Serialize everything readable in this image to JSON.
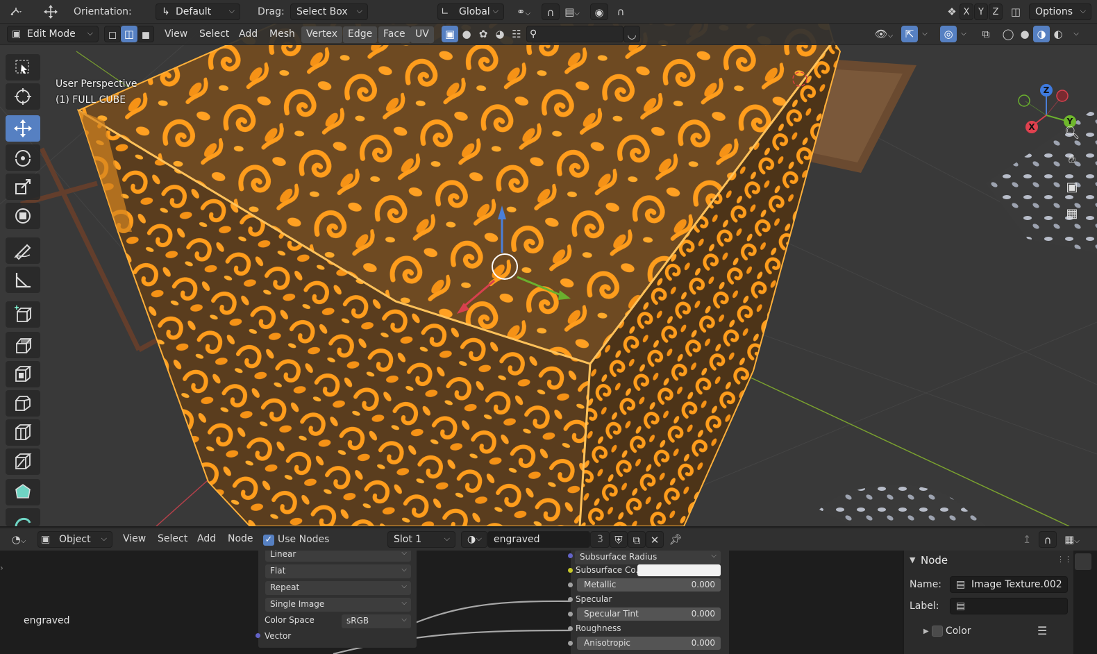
{
  "header": {
    "orientation_label": "Orientation:",
    "orientation_value": "Default",
    "drag_label": "Drag:",
    "drag_value": "Select Box",
    "transform_orientation": "Global",
    "mirror_x": "X",
    "mirror_y": "Y",
    "mirror_z": "Z",
    "options": "Options"
  },
  "header2": {
    "mode": "Edit Mode",
    "menus": [
      "View",
      "Select",
      "Add",
      "Mesh",
      "Vertex",
      "Edge",
      "Face",
      "UV"
    ],
    "highlighted_menus": [
      "Vertex",
      "Edge",
      "Face",
      "UV"
    ]
  },
  "viewport": {
    "perspective": "User Perspective",
    "object": "(1) FULL CUBE",
    "axis_x": "X",
    "axis_y": "Y",
    "axis_z": "Z"
  },
  "node_editor": {
    "header": {
      "editor_type": "Object",
      "menus": [
        "View",
        "Select",
        "Add",
        "Node"
      ],
      "use_nodes_label": "Use Nodes",
      "use_nodes_checked": true,
      "slot": "Slot 1",
      "material": "engraved",
      "user_count": "3"
    },
    "frame_label": "engraved",
    "image_node": {
      "interpolation": "Linear",
      "projection": "Flat",
      "extension": "Repeat",
      "source": "Single Image",
      "color_space_label": "Color Space",
      "color_space": "sRGB",
      "vector_label": "Vector"
    },
    "bsdf_node": {
      "subsurface_method": "Subsurface Radius",
      "subsurface_color_label": "Subsurface Co...",
      "metallic_label": "Metallic",
      "metallic_value": "0.000",
      "specular_label": "Specular",
      "specular_tint_label": "Specular Tint",
      "specular_tint_value": "0.000",
      "roughness_label": "Roughness",
      "anisotropic_label": "Anisotropic",
      "anisotropic_value": "0.000"
    }
  },
  "properties_panel": {
    "title": "Node",
    "name_label": "Name:",
    "name_value": "Image Texture.002",
    "label_label": "Label:",
    "label_value": "",
    "color_label": "Color"
  },
  "colors": {
    "accent": "#5680c2",
    "selection_orange": "#ff9a1a",
    "wood_brown": "#6b4a25",
    "socket_yellow": "#c7c729",
    "socket_grey": "#a1a1a1",
    "socket_purple": "#6363c7"
  }
}
